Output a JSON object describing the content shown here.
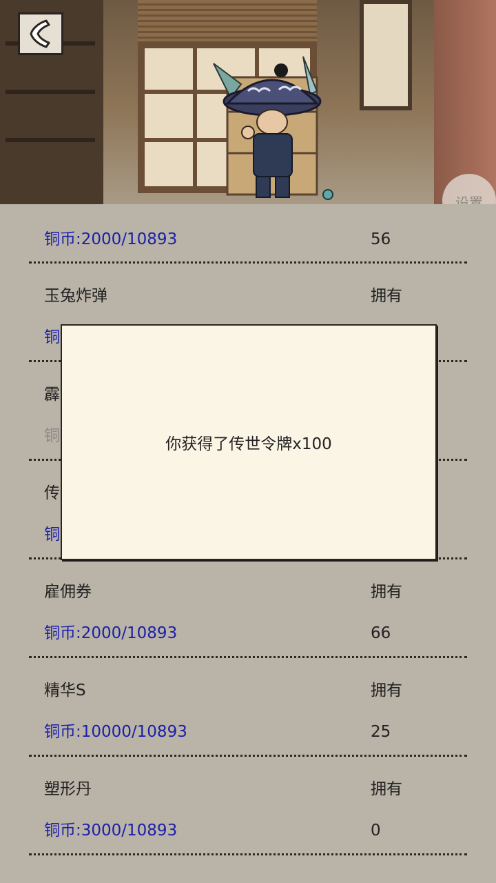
{
  "header": {
    "back_icon": "back-chevron-icon",
    "settings_label": "设置",
    "game_icon": "gamepad-icon",
    "colors": {
      "game_accent": "#f7b51e",
      "game_pad": "#3b8fe0"
    }
  },
  "items": [
    {
      "name": "",
      "own_label": "",
      "cost": "铜币:2000/10893",
      "owned": "56",
      "cost_dim": false
    },
    {
      "name": "玉兔炸弹",
      "own_label": "拥有",
      "cost": "铜",
      "owned": "",
      "cost_dim": false
    },
    {
      "name": "霹",
      "own_label": "",
      "cost": "铜",
      "owned": "",
      "cost_dim": true
    },
    {
      "name": "传",
      "own_label": "",
      "cost": "铜",
      "owned": "",
      "cost_dim": false
    },
    {
      "name": "雇佣券",
      "own_label": "拥有",
      "cost": "铜币:2000/10893",
      "owned": "66",
      "cost_dim": false
    },
    {
      "name": "精华S",
      "own_label": "拥有",
      "cost": "铜币:10000/10893",
      "owned": "25",
      "cost_dim": false
    },
    {
      "name": "塑形丹",
      "own_label": "拥有",
      "cost": "铜币:3000/10893",
      "owned": "0",
      "cost_dim": false
    }
  ],
  "dialog": {
    "message": "你获得了传世令牌x100"
  },
  "colors": {
    "cost_text": "#1c20a8",
    "list_bg": "#b9b3a8",
    "dialog_bg": "#fbf5e6"
  }
}
